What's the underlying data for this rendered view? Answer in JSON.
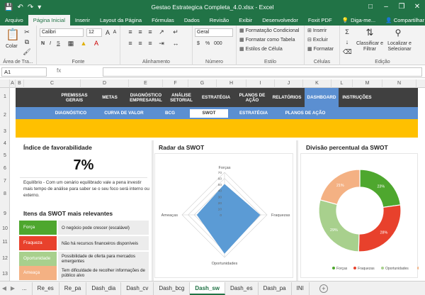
{
  "window": {
    "title": "Gestao Estrategica Completa_4.0.xlsx - Excel",
    "quick_access": [
      "save",
      "undo",
      "redo",
      "customize"
    ],
    "controls": [
      "minimize",
      "restore",
      "close"
    ]
  },
  "ribbon_tabs": [
    "Arquivo",
    "Página Inicial",
    "Inserir",
    "Layout da Página",
    "Fórmulas",
    "Dados",
    "Revisão",
    "Exibir",
    "Desenvolvedor",
    "Foxit PDF"
  ],
  "active_ribbon_tab": "Página Inicial",
  "tell_me": "Diga-me...",
  "share": "Compartilhar",
  "ribbon": {
    "clipboard": {
      "paste": "Colar",
      "label": "Área de Tra..."
    },
    "font": {
      "name": "Calibri",
      "size": "12",
      "bold": "N",
      "italic": "I",
      "underline": "S",
      "label": "Fonte"
    },
    "alignment": {
      "label": "Alinhamento"
    },
    "number": {
      "format": "Geral",
      "currency": "$",
      "percent": "%",
      "thousands": "000",
      "label": "Número"
    },
    "styles": {
      "conditional": "Formatação Condicional",
      "table": "Formatar como Tabela",
      "cell": "Estilos de Célula",
      "label": "Estilo"
    },
    "cells": {
      "insert": "Inserir",
      "delete": "Excluir",
      "format": "Formatar",
      "label": "Células"
    },
    "editing": {
      "sort": "Classificar e Filtrar",
      "find": "Localizar e Selecionar",
      "label": "Edição"
    }
  },
  "formula_bar": {
    "cell_ref": "A1",
    "fx": "fx",
    "formula": ""
  },
  "columns": [
    "A",
    "B",
    "C",
    "D",
    "E",
    "F",
    "G",
    "H",
    "I",
    "J",
    "K",
    "L",
    "M",
    "N"
  ],
  "rows": [
    "1",
    "2",
    "3",
    "4",
    "5",
    "6",
    "7",
    "8",
    "9",
    "10",
    "11",
    "12",
    "13"
  ],
  "nav_main": [
    "PREMISSAS GERAIS",
    "METAS",
    "DIAGNÓSTICO EMPRESARIAL",
    "ANÁLISE SETORIAL",
    "ESTRATÉGIA",
    "PLANOS DE AÇÃO",
    "RELATÓRIOS",
    "DASHBOARD",
    "INSTRUÇÕES"
  ],
  "nav_main_active": "DASHBOARD",
  "nav_sub": [
    "DIAGNÓSTICO",
    "CURVA DE VALOR",
    "BCG",
    "SWOT",
    "ESTRATÉGIA",
    "PLANOS DE AÇÃO"
  ],
  "nav_sub_active": "SWOT",
  "favorability": {
    "title": "Índice de favorabilidade",
    "value": "7%",
    "explanation": "Equilíbrio - Com um cenário equilibrado vale a pena investir mais tempo de análise para saber se o seu foco será interno ou externo."
  },
  "swot_items": {
    "title": "Itens da SWOT mais relevantes",
    "items": [
      {
        "tag": "Força",
        "text": "O negócio pode crescer (escalável)",
        "color": "#4ea72e"
      },
      {
        "tag": "Fraqueza",
        "text": "Não há recursos financeiros disponíveis",
        "color": "#e8412c"
      },
      {
        "tag": "Oportunidade",
        "text": "Possibilidade de oferta para mercados emergentes",
        "color": "#a8d08d"
      },
      {
        "tag": "Ameaça",
        "text": "Tem dificuldade de recolher informações de público alvo",
        "color": "#f4b183"
      }
    ]
  },
  "radar": {
    "title": "Radar da SWOT",
    "axes": [
      "Forças",
      "Fraquezas",
      "Oportunidades",
      "Ameaças"
    ],
    "ticks": [
      "0",
      "10",
      "20",
      "30",
      "40",
      "50",
      "60",
      "70"
    ],
    "color": "#5b9bd5"
  },
  "donut": {
    "title": "Divisão percentual da SWOT",
    "legend": [
      "Forças",
      "Fraquezas",
      "Oportunidades",
      "Amea"
    ],
    "slice_labels": [
      "23%",
      "28%",
      "29%",
      "21%"
    ]
  },
  "chart_data": [
    {
      "type": "radar",
      "title": "Radar da SWOT",
      "categories": [
        "Forças",
        "Fraquezas",
        "Oportunidades",
        "Ameaças"
      ],
      "values": [
        50,
        58,
        63,
        45
      ],
      "ylim": [
        0,
        70
      ],
      "grid": true
    },
    {
      "type": "pie",
      "title": "Divisão percentual da SWOT",
      "categories": [
        "Forças",
        "Fraquezas",
        "Oportunidades",
        "Ameaças"
      ],
      "values": [
        23,
        28,
        29,
        21
      ],
      "colors": [
        "#4ea72e",
        "#e8412c",
        "#a8d08d",
        "#f4b183"
      ],
      "legend": "bottom"
    }
  ],
  "sheet_tabs": [
    "...",
    "Re_es",
    "Re_pa",
    "Dash_dia",
    "Dash_cv",
    "Dash_bcg",
    "Dash_sw",
    "Dash_es",
    "Dash_pa",
    "INI"
  ],
  "active_sheet": "Dash_sw"
}
